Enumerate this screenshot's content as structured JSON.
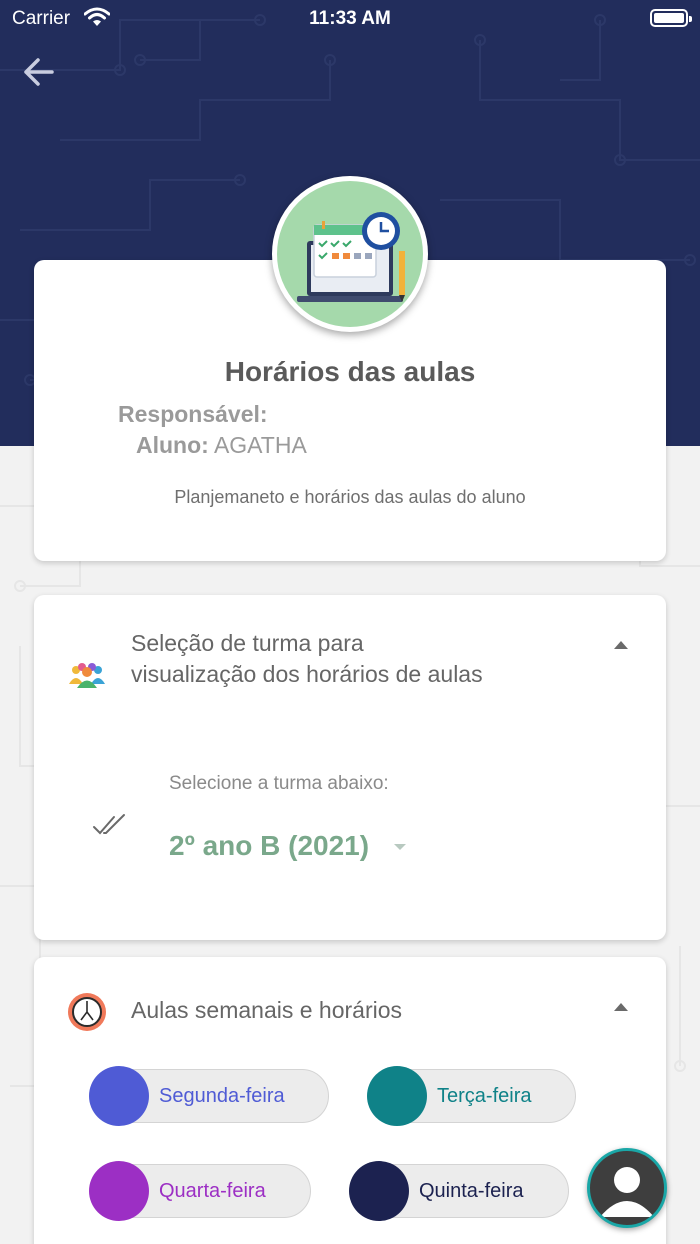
{
  "status_bar": {
    "carrier": "Carrier",
    "time": "11:33 AM"
  },
  "info_card": {
    "title": "Horários das aulas",
    "responsavel_label": "Responsável:",
    "responsavel_value": "",
    "aluno_label": "Aluno:",
    "aluno_value": "AGATHA",
    "description": "Planjemaneto e horários das aulas do aluno"
  },
  "turma_card": {
    "title": "Seleção de turma para visualização dos horários de aulas",
    "select_label": "Selecione a turma abaixo:",
    "selected_turma": "2º ano B (2021)"
  },
  "aulas_card": {
    "title": "Aulas semanais e horários",
    "days": [
      {
        "label": "Segunda-feira",
        "color": "#4f5bd5"
      },
      {
        "label": "Terça-feira",
        "color": "#0f8288"
      },
      {
        "label": "Quarta-feira",
        "color": "#9c2fc4"
      },
      {
        "label": "Quinta-feira",
        "color": "#1c2250"
      }
    ]
  },
  "icons": [
    "back-arrow-icon",
    "wifi-icon",
    "battery-icon",
    "schedule-icon",
    "group-icon",
    "double-check-icon",
    "clock-icon",
    "user-avatar-icon"
  ],
  "colors": {
    "header": "#222d5c",
    "accent_green": "#7aa88b",
    "hero_circle": "#a5d9ab"
  }
}
